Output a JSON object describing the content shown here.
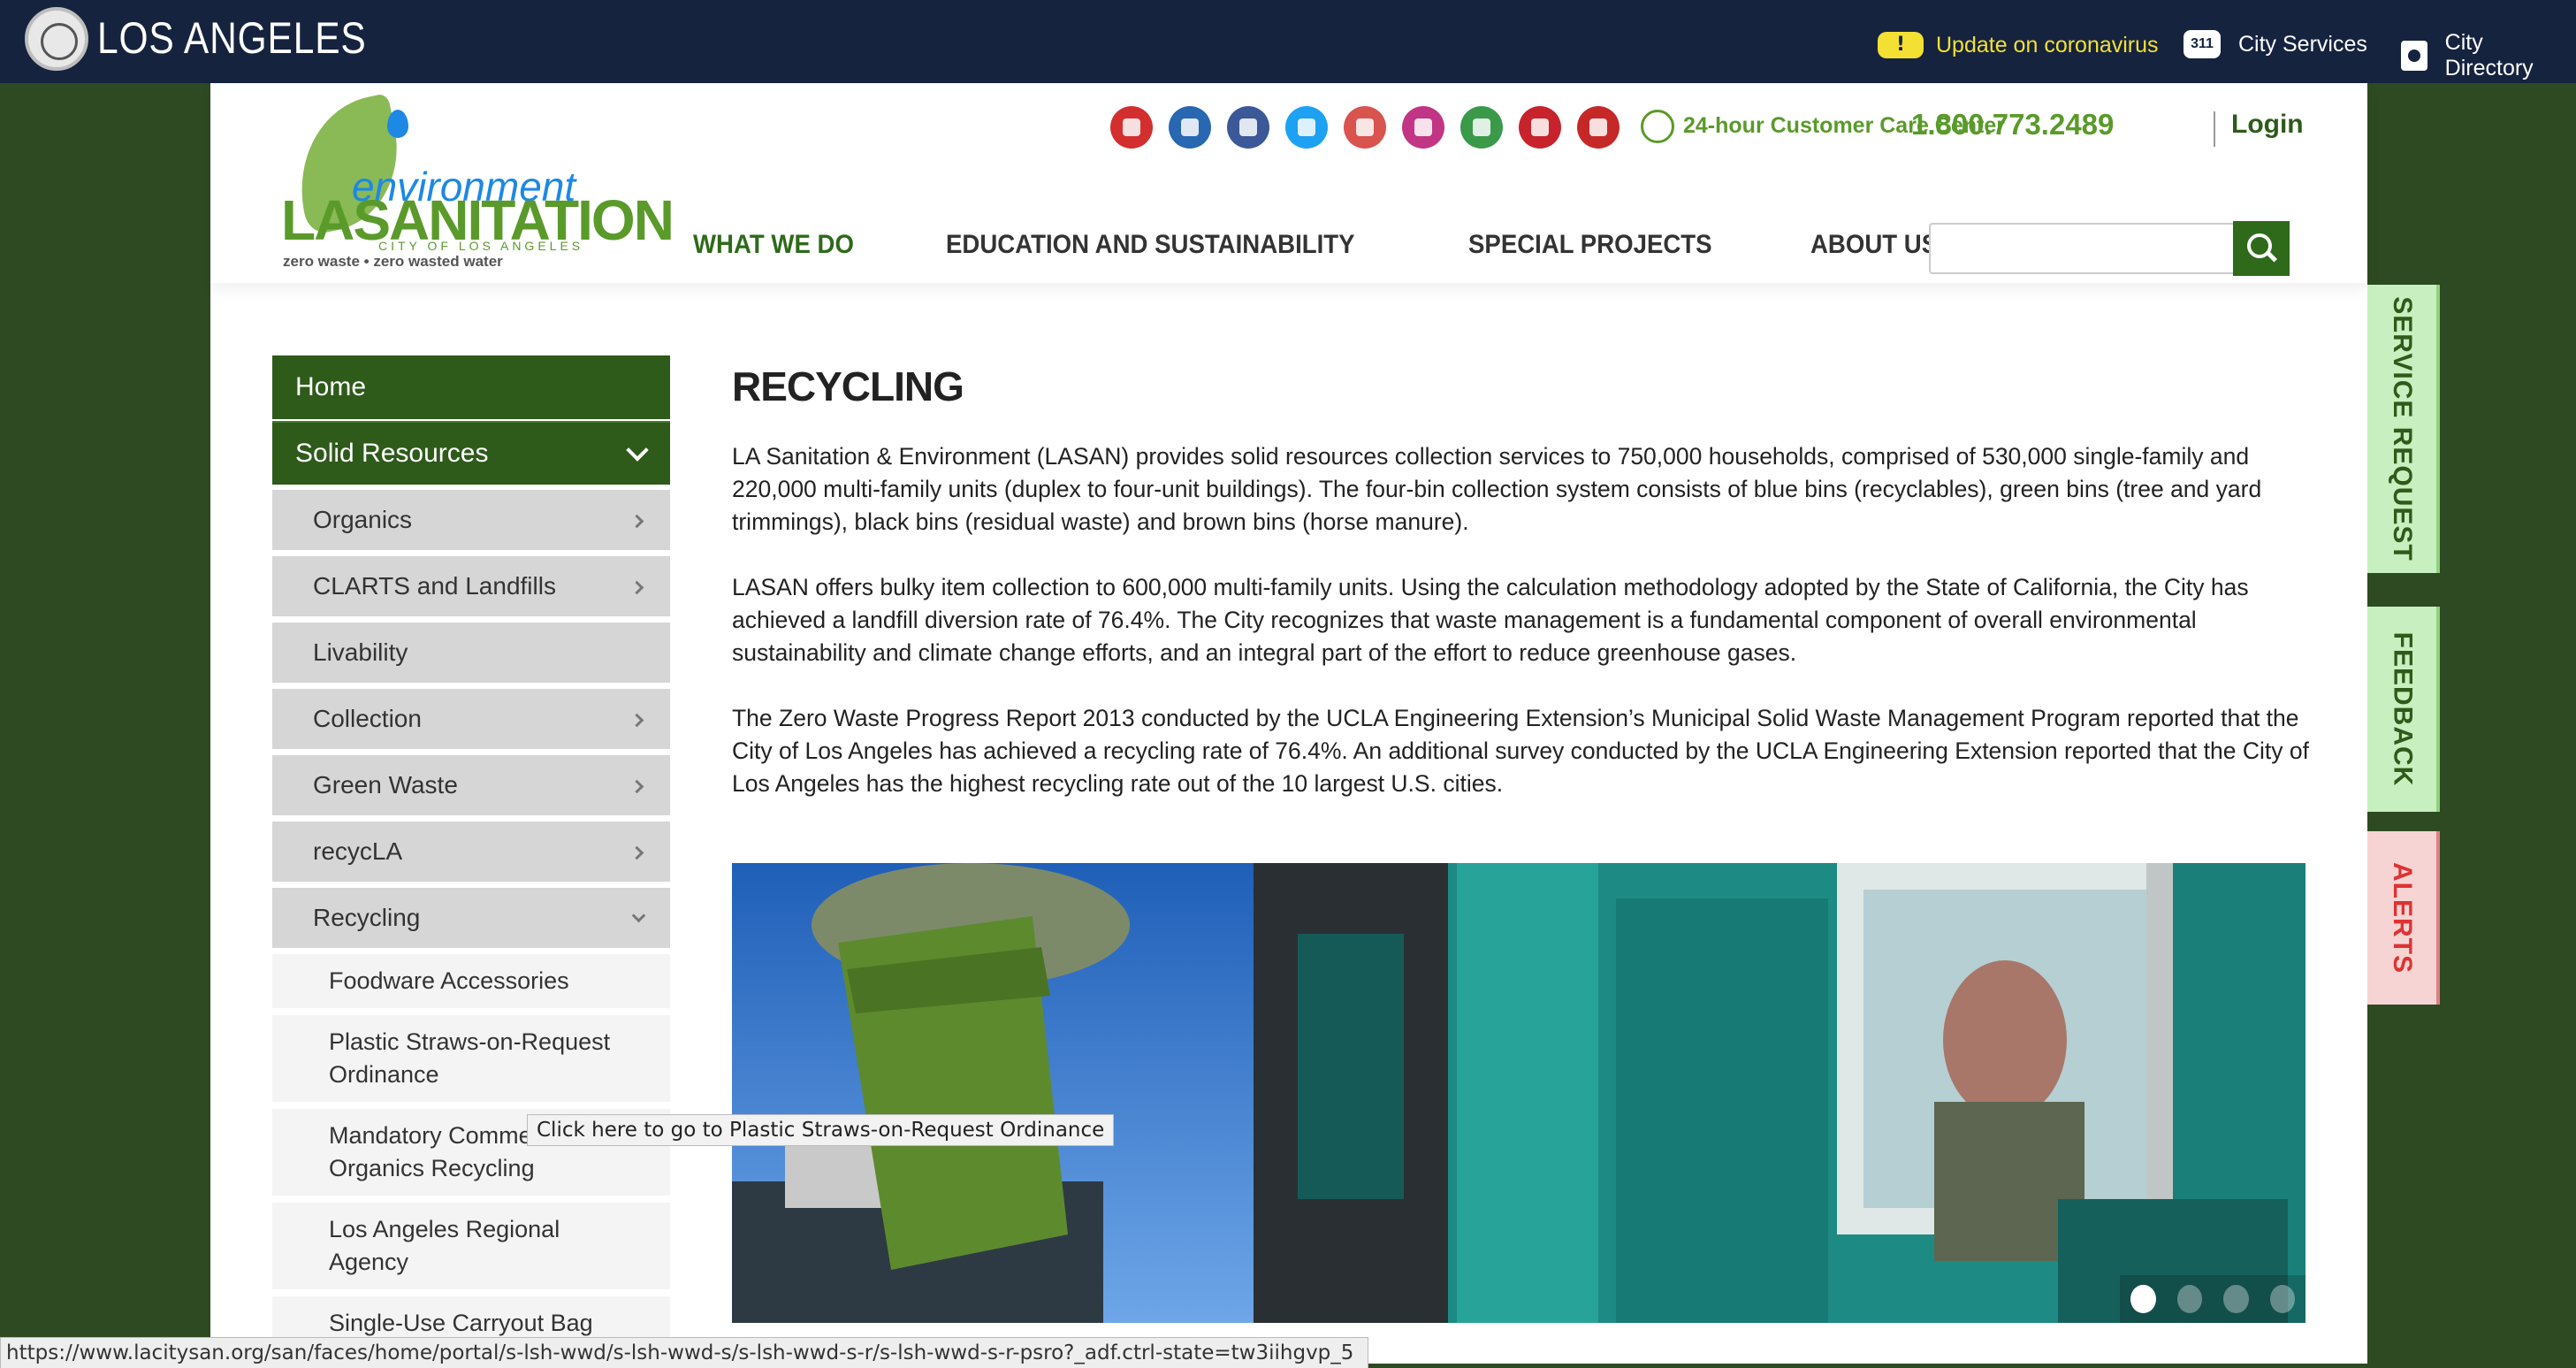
{
  "topbar": {
    "city_name": "LOS ANGELES",
    "alert_badge": "!",
    "covid_link": "Update on coronavirus",
    "badge_311": "311",
    "city_services": "City Services",
    "city_directory": "City Directory"
  },
  "header": {
    "logo": {
      "environment": "environment",
      "lasanitation": "LASANITATION",
      "city": "CITY OF LOS ANGELES",
      "tagline": "zero waste • zero wasted water"
    },
    "care_label": "24-hour Customer Care Center",
    "phone": "1.800.773.2489",
    "login": "Login",
    "social_icons": [
      {
        "name": "alert-icon",
        "color": "#d32f2f"
      },
      {
        "name": "linkedin-icon",
        "color": "#2867b2"
      },
      {
        "name": "facebook-icon",
        "color": "#3b5998"
      },
      {
        "name": "twitter-icon",
        "color": "#1da1f2"
      },
      {
        "name": "youtube-icon",
        "color": "#d9534f"
      },
      {
        "name": "instagram-icon",
        "color": "#c13584"
      },
      {
        "name": "nextdoor-icon",
        "color": "#3a9a4a"
      },
      {
        "name": "pinterest-icon",
        "color": "#c8232c"
      },
      {
        "name": "email-icon",
        "color": "#c62828"
      }
    ],
    "nav": [
      "WHAT WE DO",
      "EDUCATION AND SUSTAINABILITY",
      "SPECIAL PROJECTS",
      "ABOUT US"
    ],
    "search_placeholder": ""
  },
  "sidebar": {
    "home": "Home",
    "solid_resources": "Solid Resources",
    "items": [
      "Organics",
      "CLARTS and Landfills",
      "Livability",
      "Collection",
      "Green Waste",
      "recycLA",
      "Recycling"
    ],
    "recycling_sub": [
      "Foodware Accessories",
      "Plastic Straws-on-Request Ordinance",
      "Mandatory Commercial Organics Recycling",
      "Los Angeles Regional Agency",
      "Single-Use Carryout Bag"
    ]
  },
  "main": {
    "title": "RECYCLING",
    "paragraphs": [
      "LA Sanitation & Environment (LASAN) provides solid resources collection services to 750,000 households, comprised of 530,000 single-family and 220,000 multi-family units (duplex to four-unit buildings). The four-bin collection system consists of blue bins (recyclables), green bins (tree and yard trimmings), black bins (residual waste) and brown bins (horse manure).",
      "LASAN offers bulky item collection to 600,000 multi-family units. Using the calculation methodology adopted by the State of California, the City has achieved a landfill diversion rate of 76.4%. The City recognizes that waste management is a fundamental component of overall environmental sustainability and climate change efforts, and an integral part of the effort to reduce greenhouse gases.",
      "The Zero Waste Progress Report 2013 conducted by the UCLA Engineering Extension’s Municipal Solid Waste Management Program reported that the City of Los Angeles has achieved a recycling rate of 76.4%. An additional survey conducted by the UCLA Engineering Extension reported that the City of Los Angeles has the highest recycling rate out of the 10 largest U.S. cities."
    ],
    "slider_active": 1,
    "slider_count": 4
  },
  "right_tabs": {
    "service_request": "SERVICE REQUEST",
    "feedback": "FEEDBACK",
    "alerts": "ALERTS"
  },
  "tooltip": "Click here to go to Plastic Straws-on-Request Ordinance",
  "statusbar": "https://www.lacitysan.org/san/faces/home/portal/s-lsh-wwd/s-lsh-wwd-s/s-lsh-wwd-s-r/s-lsh-wwd-s-r-psro?_adf.ctrl-state=tw3iihgvp_5"
}
